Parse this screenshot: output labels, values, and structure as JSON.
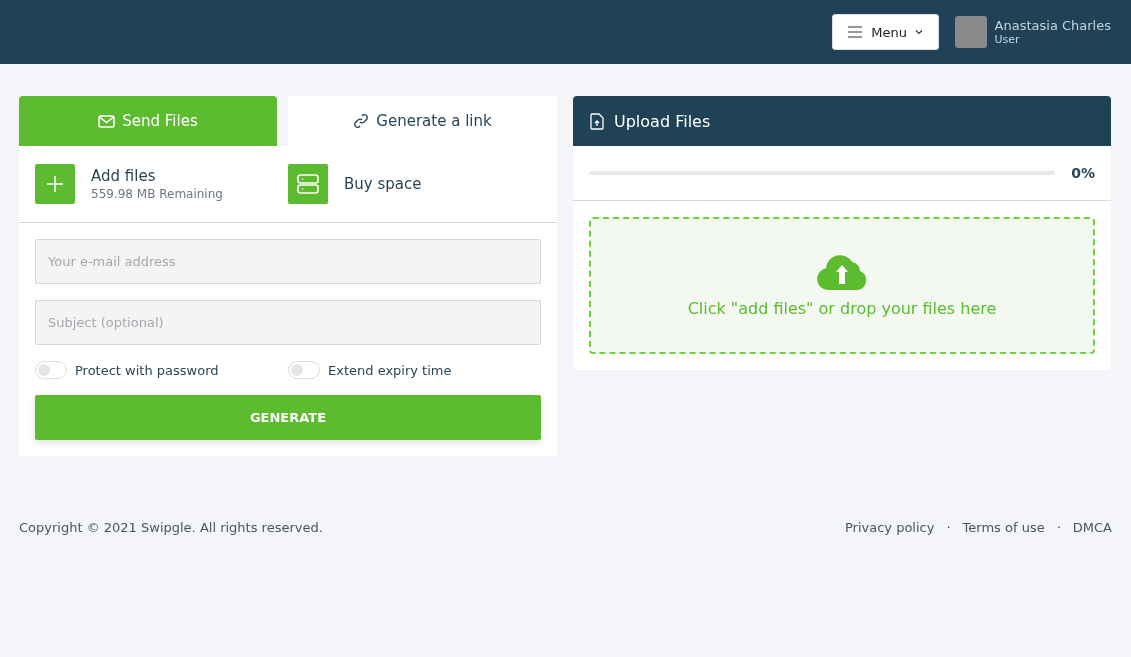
{
  "header": {
    "menu_button": "Menu",
    "user": {
      "name": "Anastasia Charles",
      "role": "User"
    }
  },
  "tabs": [
    {
      "label": "Send Files",
      "selected": true,
      "kind": "mail"
    },
    {
      "label": "Generate a link",
      "selected": false,
      "kind": "link"
    }
  ],
  "actions": [
    {
      "kind": "add",
      "title": "Add files",
      "subtitle": "559.98 MB Remaining"
    },
    {
      "kind": "buy",
      "title": "Buy space"
    }
  ],
  "fields": [
    {
      "placeholder": "Your e-mail address"
    },
    {
      "placeholder": "Subject (optional)"
    }
  ],
  "toggles": [
    {
      "label": "Protect with password",
      "on": false
    },
    {
      "label": "Extend expiry time",
      "on": false
    }
  ],
  "generate_button": "GENERATE",
  "upload": {
    "title": "Upload Files",
    "progress": {
      "level": 0,
      "reading": "0%"
    },
    "drop_text": "Click \"add files\" or drop your files here"
  },
  "footer": {
    "copyright": "Copyright © 2021 Swipgle. All rights reserved.",
    "links": [
      "Privacy policy",
      "Terms of use",
      "DMCA"
    ],
    "separator": "·"
  }
}
